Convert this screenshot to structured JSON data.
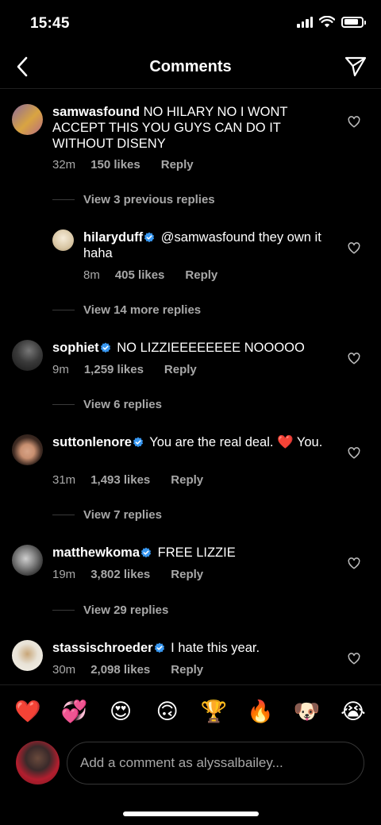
{
  "status_bar": {
    "time": "15:45",
    "battery_level": 0.85
  },
  "header": {
    "title": "Comments",
    "back_icon": "chevron-left-icon",
    "send_icon": "paper-plane-icon"
  },
  "comments": [
    {
      "username": "samwasfound",
      "verified": false,
      "text": "NO HILARY NO I WONT ACCEPT THIS YOU GUYS CAN DO IT WITHOUT DISENY",
      "time": "32m",
      "likes": "150 likes",
      "reply_label": "Reply",
      "avatar_colors": [
        "#8b6a9e",
        "#d9a441"
      ]
    },
    {
      "username": "hilaryduff",
      "verified": true,
      "text": "@samwasfound they own it haha",
      "time": "8m",
      "likes": "405 likes",
      "reply_label": "Reply",
      "avatar_colors": [
        "#d8c6a4",
        "#f0e4cf"
      ]
    },
    {
      "username": "sophiet",
      "verified": true,
      "text": "NO LIZZIEEEEEEEE NOOOOO",
      "time": "9m",
      "likes": "1,259 likes",
      "reply_label": "Reply",
      "avatar_colors": [
        "#555555",
        "#222222"
      ]
    },
    {
      "username": "suttonlenore",
      "verified": true,
      "text": "You are the real deal. ❤️ You.",
      "time": "31m",
      "likes": "1,493 likes",
      "reply_label": "Reply",
      "avatar_colors": [
        "#3d2a22",
        "#c88f70"
      ]
    },
    {
      "username": "matthewkoma",
      "verified": true,
      "text": "FREE LIZZIE",
      "time": "19m",
      "likes": "3,802 likes",
      "reply_label": "Reply",
      "avatar_colors": [
        "#9a9a9a",
        "#3a3a3a"
      ]
    },
    {
      "username": "stassischroeder",
      "verified": true,
      "text": "I hate this year.",
      "time": "30m",
      "likes": "2,098 likes",
      "reply_label": "Reply",
      "avatar_colors": [
        "#e8e2d6",
        "#b89a6a"
      ]
    }
  ],
  "view_replies": [
    "View 3 previous replies",
    "View 14 more replies",
    "View 6 replies",
    "View 7 replies",
    "View 29 replies"
  ],
  "emoji_bar": [
    "❤️",
    "💞",
    "😍",
    "🙃",
    "🏆",
    "🔥",
    "🐶",
    "😭"
  ],
  "comment_input": {
    "placeholder": "Add a comment as alyssalbailey..."
  },
  "colors": {
    "background": "#000000",
    "secondary_text": "#a8a8a8",
    "verified_blue": "#3897f0",
    "divider": "#1f1f1f"
  }
}
